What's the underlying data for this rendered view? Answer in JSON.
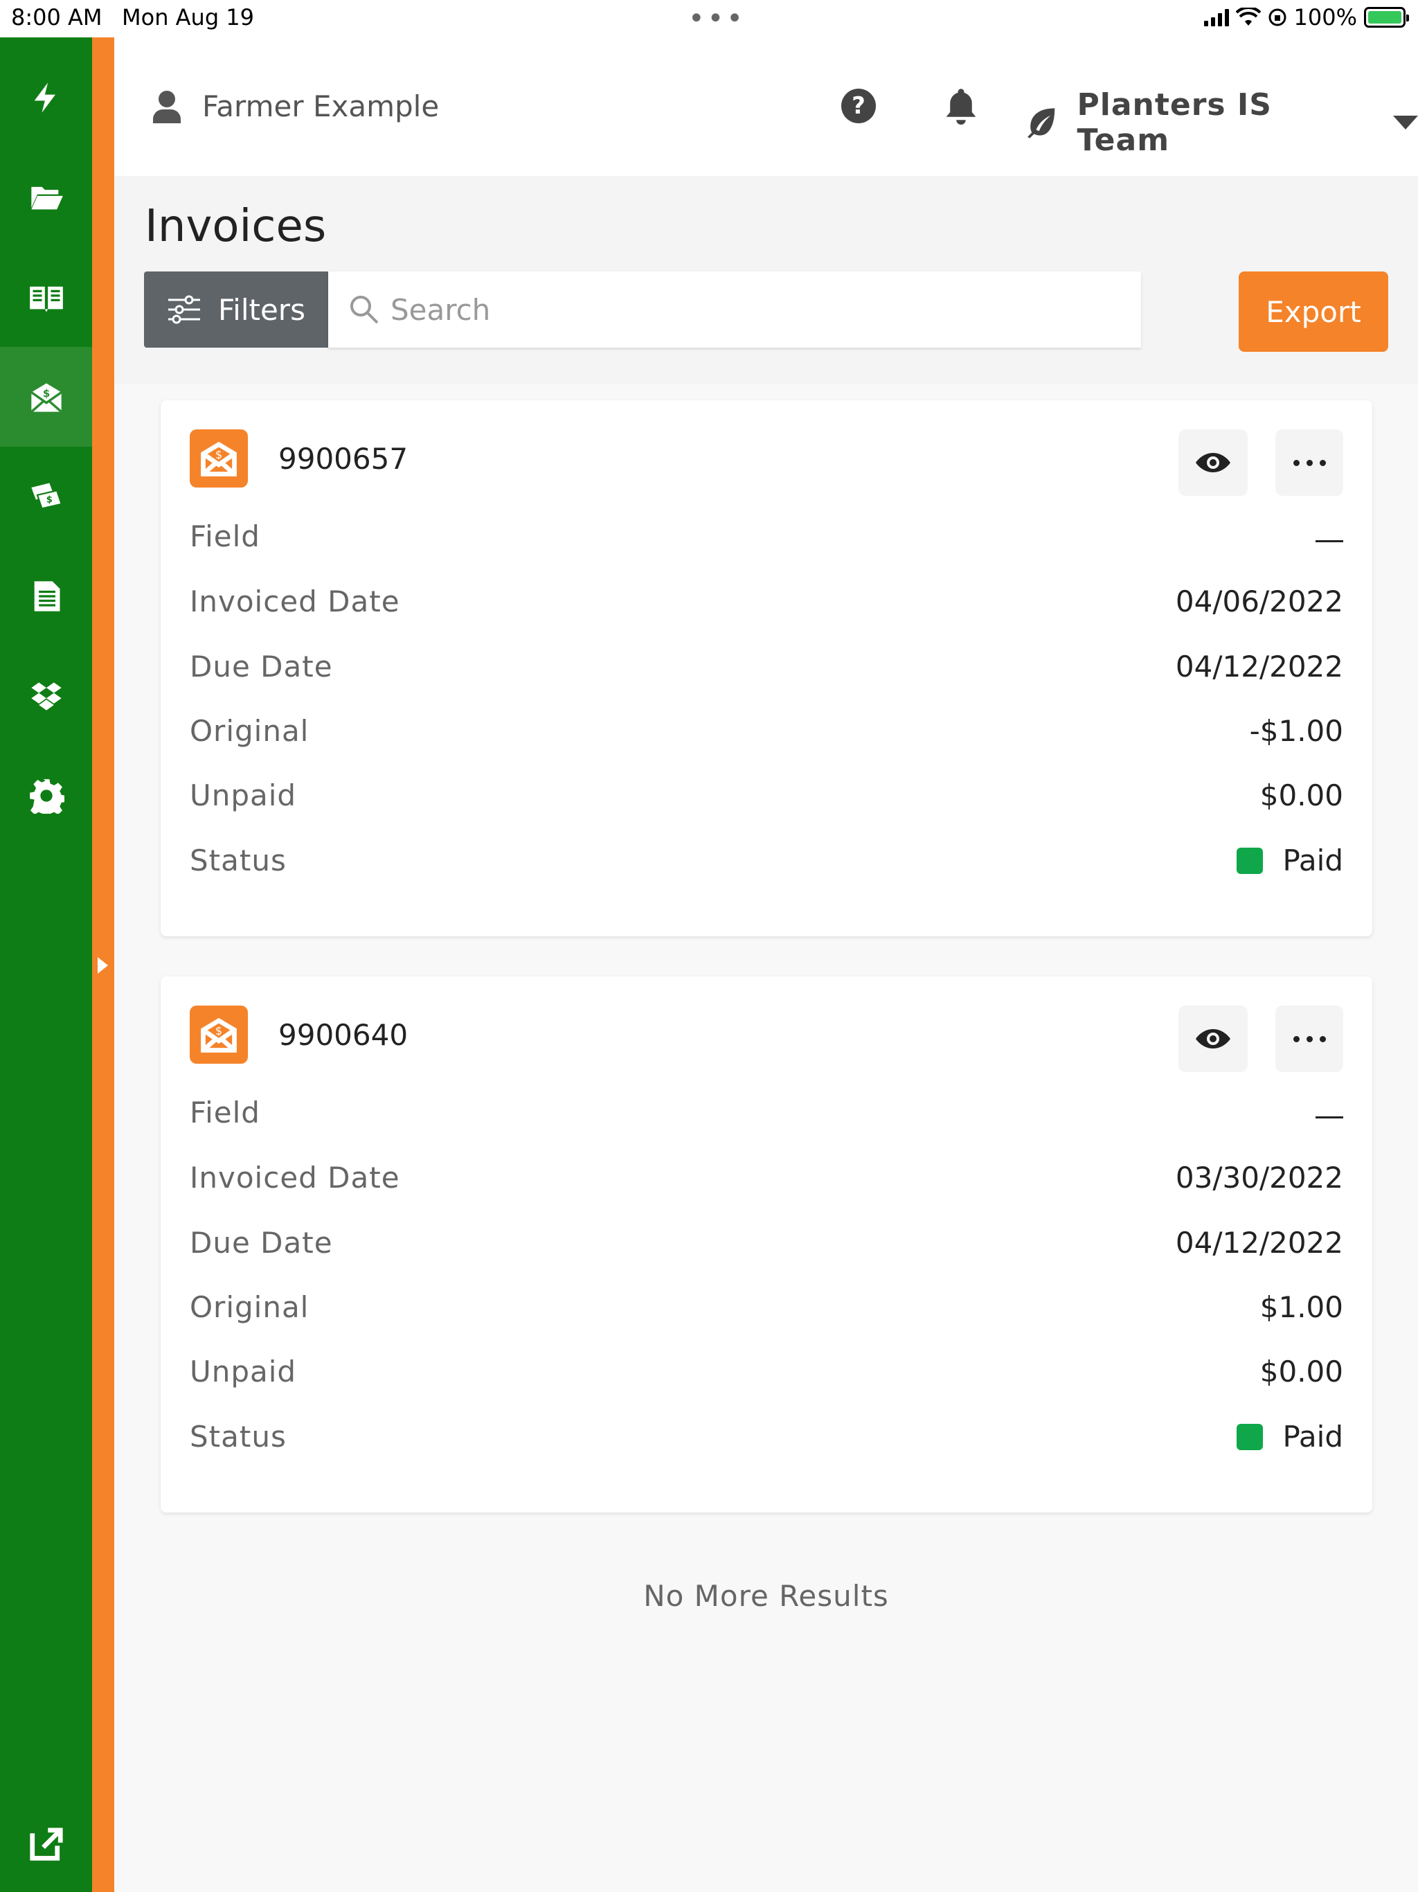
{
  "status_bar": {
    "time": "8:00 AM",
    "date": "Mon Aug 19",
    "battery": "100%"
  },
  "sidebar": {
    "items": [
      {
        "icon": "lightning-icon"
      },
      {
        "icon": "folder-icon"
      },
      {
        "icon": "book-icon"
      },
      {
        "icon": "invoice-envelope-icon",
        "active": true
      },
      {
        "icon": "money-icon"
      },
      {
        "icon": "document-icon"
      },
      {
        "icon": "dropbox-icon"
      },
      {
        "icon": "gear-icon"
      }
    ],
    "bottom_icon": "external-link-icon"
  },
  "header": {
    "user_name": "Farmer Example",
    "team_name": "Planters IS Team"
  },
  "page": {
    "title": "Invoices"
  },
  "toolbar": {
    "filters_label": "Filters",
    "search_placeholder": "Search",
    "export_label": "Export"
  },
  "invoices": [
    {
      "number": "9900657",
      "rows": {
        "field_label": "Field",
        "field_value": "—",
        "invoiced_label": "Invoiced Date",
        "invoiced_value": "04/06/2022",
        "due_label": "Due Date",
        "due_value": "04/12/2022",
        "original_label": "Original",
        "original_value": "-$1.00",
        "unpaid_label": "Unpaid",
        "unpaid_value": "$0.00",
        "status_label": "Status",
        "status_value": "Paid"
      },
      "status_color": "#0fa74a"
    },
    {
      "number": "9900640",
      "rows": {
        "field_label": "Field",
        "field_value": "—",
        "invoiced_label": "Invoiced Date",
        "invoiced_value": "03/30/2022",
        "due_label": "Due Date",
        "due_value": "04/12/2022",
        "original_label": "Original",
        "original_value": "$1.00",
        "unpaid_label": "Unpaid",
        "unpaid_value": "$0.00",
        "status_label": "Status",
        "status_value": "Paid"
      },
      "status_color": "#0fa74a"
    }
  ],
  "footer": {
    "no_more": "No More Results"
  },
  "colors": {
    "sidebar": "#0f7d15",
    "accent": "#f5832a",
    "paid": "#0fa74a"
  }
}
